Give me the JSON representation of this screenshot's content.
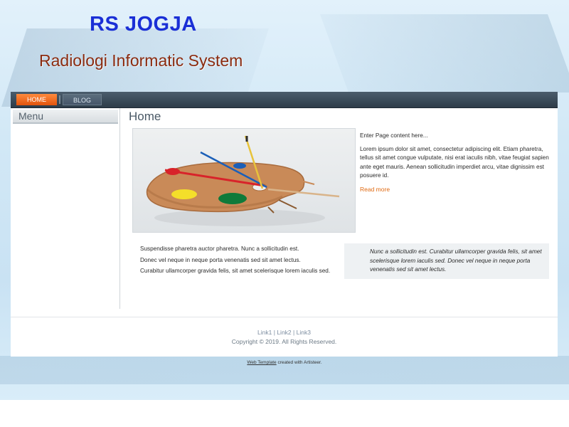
{
  "header": {
    "title": "RS JOGJA",
    "slogan": "Radiologi Informatic System"
  },
  "nav": {
    "home_label": "HOME",
    "blog_label": "BLOG"
  },
  "sidebar": {
    "title": "Menu"
  },
  "post": {
    "title": "Home",
    "image_icon": "palette-image",
    "intro_line": "Enter Page content here...",
    "body": "Lorem ipsum dolor sit amet, consectetur adipiscing elit. Etiam pharetra, tellus sit amet congue vulputate, nisi erat iaculis nibh, vitae feugiat sapien ante eget mauris. Aenean sollicitudin imperdiet arcu, vitae dignissim est posuere id.",
    "read_more": "Read more",
    "list": [
      "Suspendisse pharetra auctor pharetra. Nunc a sollicitudin est.",
      "Donec vel neque in neque porta venenatis sed sit amet lectus.",
      "Curabitur ullamcorper gravida felis, sit amet scelerisque lorem iaculis sed."
    ],
    "quote": "Nunc a sollicitudin est. Curabitur ullamcorper gravida felis, sit amet scelerisque lorem iaculis sed. Donec vel neque in neque porta venenatis sed sit amet lectus."
  },
  "footer": {
    "link1": "Link1",
    "link2": "Link2",
    "link3": "Link3",
    "separator": "|",
    "copyright": "Copyright © 2019. All Rights Reserved."
  },
  "credit": {
    "link_text": "Web Template",
    "suffix": "created with Artisteer."
  },
  "colors": {
    "title": "#1a2fd6",
    "slogan": "#8a2b10",
    "nav_active": "#e2540e",
    "read_more": "#e06a12"
  }
}
